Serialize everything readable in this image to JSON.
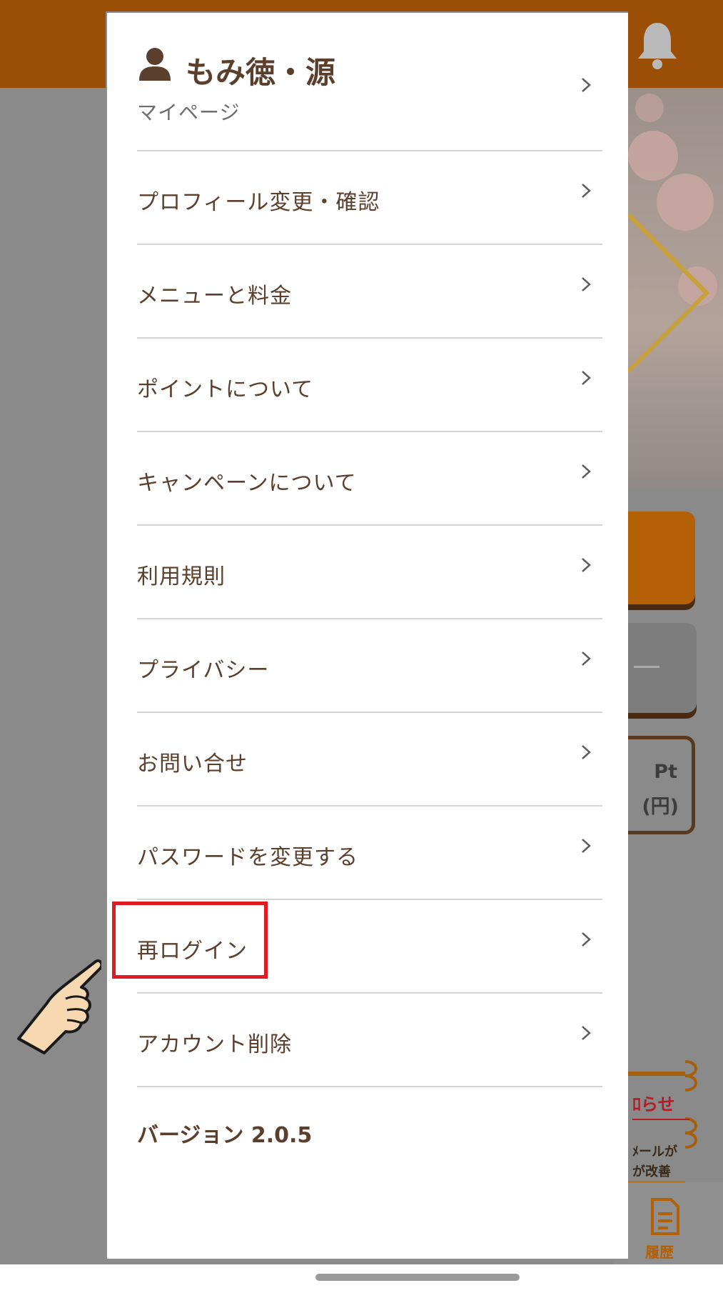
{
  "drawer": {
    "profile": {
      "name": "もみ徳・源",
      "subtitle": "マイページ"
    },
    "items": [
      {
        "label": "プロフィール変更・確認"
      },
      {
        "label": "メニューと料金"
      },
      {
        "label": "ポイントについて"
      },
      {
        "label": "キャンペーンについて"
      },
      {
        "label": "利用規則"
      },
      {
        "label": "プライバシー"
      },
      {
        "label": "お問い合せ"
      },
      {
        "label": "パスワードを変更する"
      },
      {
        "label": "再ログイン"
      },
      {
        "label": "アカウント削除"
      }
    ],
    "version": "バージョン 2.0.5"
  },
  "background": {
    "pt_label": "Pt",
    "yen_label": "(円)",
    "notice_title": "ﾛらせ",
    "notice_text1": "ﾒールが",
    "notice_text2": "が改善",
    "tab_label": "履歴"
  },
  "colors": {
    "accent_brown": "#5b3f2d",
    "highlight_red": "#e01b24",
    "header_orange": "#9a4e06"
  }
}
